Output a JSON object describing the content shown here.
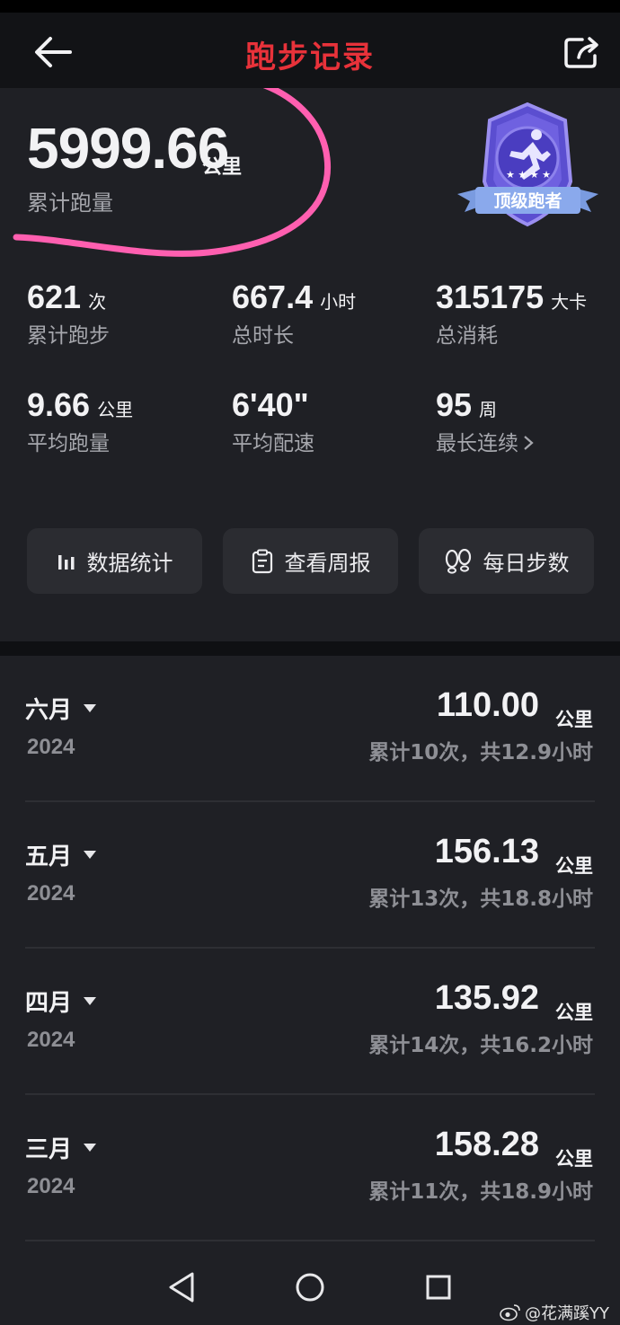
{
  "header": {
    "title": "跑步记录"
  },
  "summary": {
    "total_value": "5999.66",
    "total_unit": "公里",
    "total_label": "累计跑量",
    "badge_label": "顶级跑者",
    "stats": [
      {
        "value": "621",
        "unit": "次",
        "label": "累计跑步"
      },
      {
        "value": "667.4",
        "unit": "小时",
        "label": "总时长"
      },
      {
        "value": "315175",
        "unit": "大卡",
        "label": "总消耗"
      },
      {
        "value": "9.66",
        "unit": "公里",
        "label": "平均跑量"
      },
      {
        "value": "6'40\"",
        "unit": "",
        "label": "平均配速"
      },
      {
        "value": "95",
        "unit": "周",
        "label": "最长连续"
      }
    ]
  },
  "buttons": [
    {
      "label": "数据统计",
      "icon": "bar-chart-icon"
    },
    {
      "label": "查看周报",
      "icon": "clipboard-icon"
    },
    {
      "label": "每日步数",
      "icon": "footprints-icon"
    }
  ],
  "months": [
    {
      "month": "六月",
      "year": "2024",
      "distance": "110.00",
      "unit": "公里",
      "detail": "累计10次，共12.9小时"
    },
    {
      "month": "五月",
      "year": "2024",
      "distance": "156.13",
      "unit": "公里",
      "detail": "累计13次，共18.8小时"
    },
    {
      "month": "四月",
      "year": "2024",
      "distance": "135.92",
      "unit": "公里",
      "detail": "累计14次，共16.2小时"
    },
    {
      "month": "三月",
      "year": "2024",
      "distance": "158.28",
      "unit": "公里",
      "detail": "累计11次，共18.9小时"
    }
  ],
  "watermark": "@花满蹊YY",
  "colors": {
    "title": "#e8323a",
    "highlight_stroke": "#ff5fb0",
    "badge": "#6a5bd6"
  }
}
